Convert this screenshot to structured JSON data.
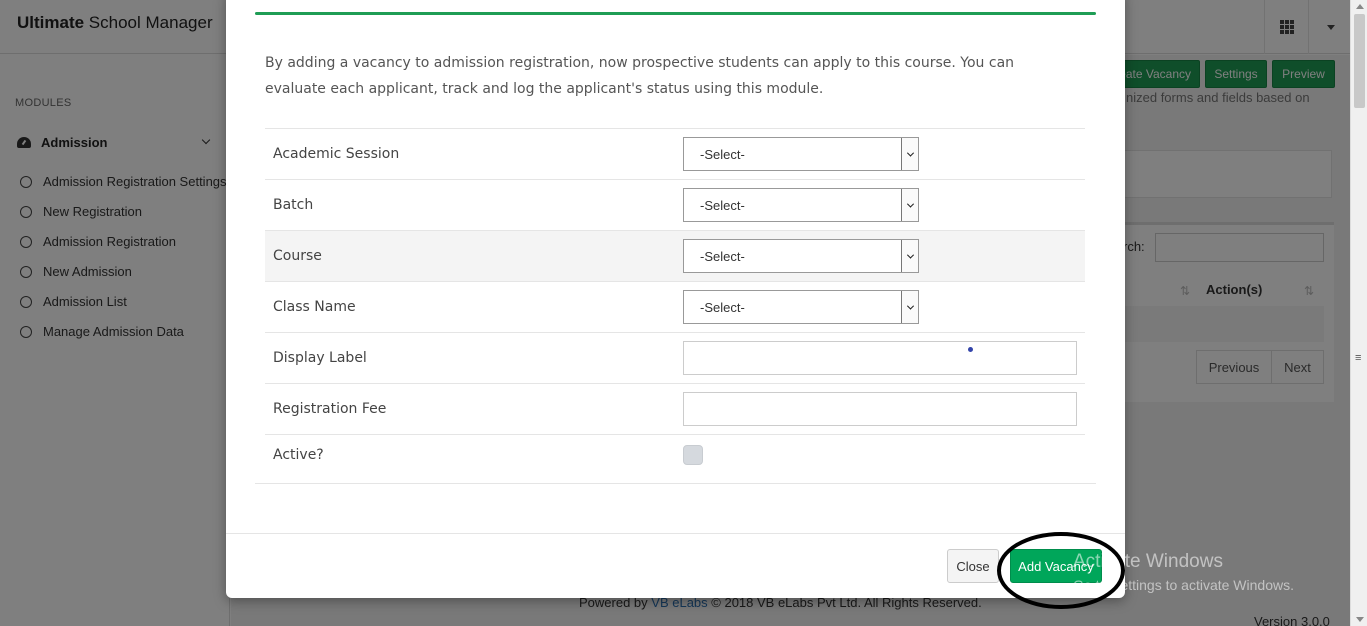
{
  "app": {
    "brand_bold": "Ultimate",
    "brand_rest": " School Manager"
  },
  "sidebar": {
    "section_label": "MODULES",
    "menu_head": "Admission",
    "items": [
      {
        "label": "Admission Registration Settings"
      },
      {
        "label": "New Registration"
      },
      {
        "label": "Admission Registration"
      },
      {
        "label": "New Admission"
      },
      {
        "label": "Admission List"
      },
      {
        "label": "Manage Admission Data"
      }
    ]
  },
  "background": {
    "create_vacancy_label": "eate Vacancy",
    "settings_label": "Settings",
    "preview_label": "Preview",
    "note": "nized forms and fields based on",
    "search_label": "rch:",
    "actions_header": "Action(s)",
    "previous_label": "Previous",
    "next_label": "Next",
    "footer_powered": "Powered by",
    "footer_link": "VB eLabs",
    "footer_copy": "© 2018 VB eLabs Pvt Ltd. All Rights Reserved.",
    "version": "Version 3.0.0"
  },
  "modal": {
    "intro": "By adding a vacancy to admission registration, now prospective students can apply to this course. You can evaluate each applicant, track and log the applicant's status using this module.",
    "fields": {
      "academic_session": {
        "label": "Academic Session",
        "value": "-Select-"
      },
      "batch": {
        "label": "Batch",
        "value": "-Select-"
      },
      "course": {
        "label": "Course",
        "value": "-Select-"
      },
      "class_name": {
        "label": "Class Name",
        "value": "-Select-"
      },
      "display_label": {
        "label": "Display Label",
        "value": ""
      },
      "registration_fee": {
        "label": "Registration Fee",
        "value": ""
      },
      "active": {
        "label": "Active?",
        "checked": false
      }
    },
    "close_label": "Close",
    "add_label": "Add Vacancy"
  },
  "watermark": {
    "line1": "Activate Windows",
    "line2": "Go to Settings to activate Windows."
  },
  "colors": {
    "accent_green": "#00a65a",
    "overlay": "rgba(0,0,0,0.5)"
  }
}
